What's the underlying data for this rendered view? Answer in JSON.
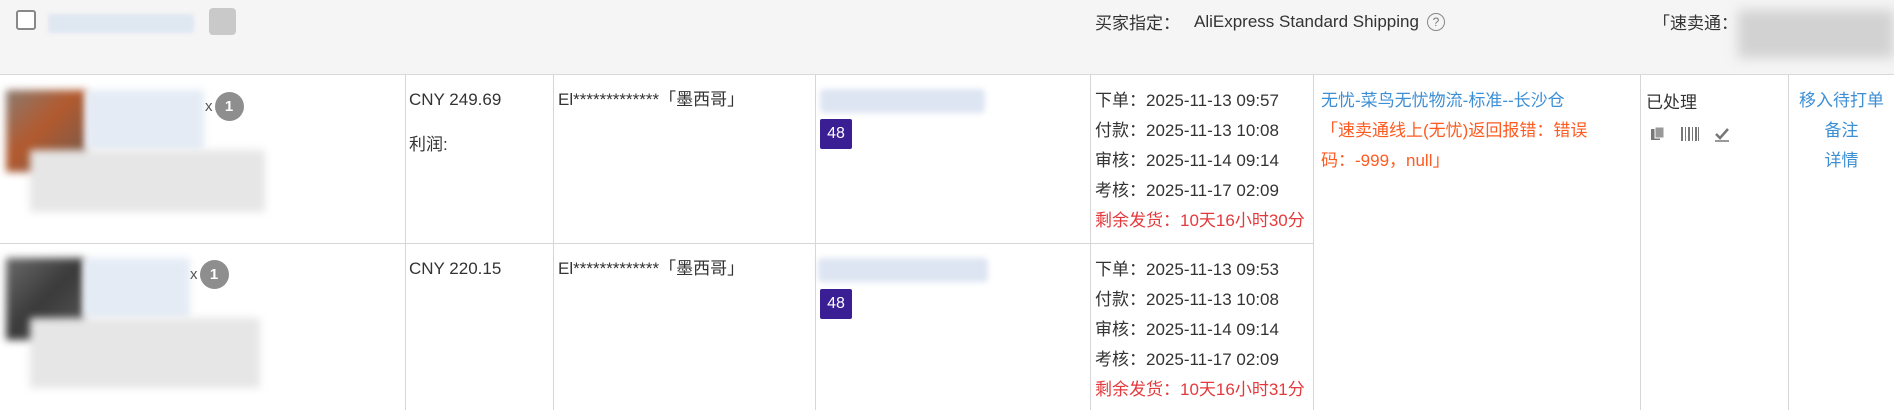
{
  "header": {
    "shipping_label": "买家指定：",
    "shipping_value": "AliExpress Standard Shipping",
    "help_icon": "?",
    "store_label": "「速卖通："
  },
  "orders": [
    {
      "qty_x": "x",
      "qty": "1",
      "price": "CNY 249.69",
      "profit_label": "利润:",
      "buyer": "El*************「墨西哥」",
      "tag": "48",
      "times": {
        "order": "下单：2025-11-13 09:57",
        "payment": "付款：2025-11-13 10:08",
        "review": "审核：2025-11-14 09:14",
        "check": "考核：2025-11-17 02:09",
        "remaining": "剩余发货：10天16小时30分"
      }
    },
    {
      "qty_x": "x",
      "qty": "1",
      "price": "CNY 220.15",
      "profit_label": "",
      "buyer": "El*************「墨西哥」",
      "tag": "48",
      "times": {
        "order": "下单：2025-11-13 09:53",
        "payment": "付款：2025-11-13 10:08",
        "review": "审核：2025-11-14 09:14",
        "check": "考核：2025-11-17 02:09",
        "remaining": "剩余发货：10天16小时31分"
      }
    }
  ],
  "logistics": {
    "link": "无忧-菜鸟无忧物流-标准--长沙仓",
    "error": "「速卖通线上(无忧)返回报错：错误码：-999，null」"
  },
  "status": {
    "label": "已处理",
    "icons": [
      "copy-icon",
      "barcode-icon",
      "check-icon"
    ]
  },
  "actions": {
    "move": "移入待打单",
    "note": "备注",
    "detail": "详情"
  },
  "colors": {
    "link": "#3d8fd5",
    "error": "#ff5a1f",
    "remaining": "#e4393c",
    "tag": "#3a1f94"
  }
}
